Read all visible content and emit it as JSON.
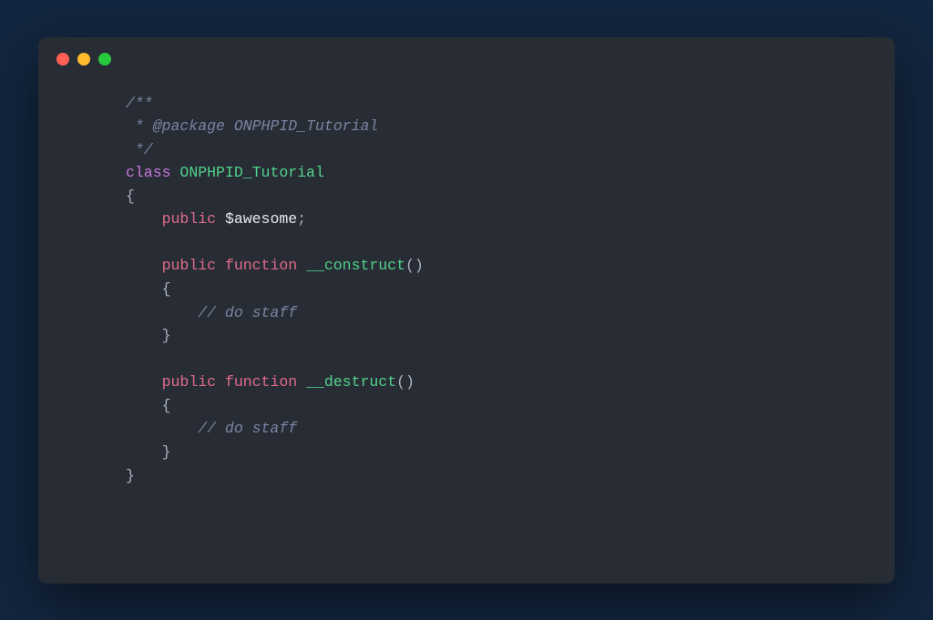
{
  "titlebar": {
    "dots": {
      "red": "#ff5f56",
      "yellow": "#ffbd2e",
      "green": "#27c93f"
    }
  },
  "code": {
    "c1": "/**",
    "c2": " * @package ONPHPID_Tutorial",
    "c3": " */",
    "kw_class": "class",
    "classname": "ONPHPID_Tutorial",
    "brace_open": "{",
    "kw_public1": "public",
    "var_awesome": "$awesome",
    "semi": ";",
    "kw_public2": "public",
    "kw_function1": "function",
    "func_construct": "__construct",
    "parens": "()",
    "brace_open2": "{",
    "comment_staff1": "// do staff",
    "brace_close2": "}",
    "kw_public3": "public",
    "kw_function2": "function",
    "func_destruct": "__destruct",
    "parens2": "()",
    "brace_open3": "{",
    "comment_staff2": "// do staff",
    "brace_close3": "}",
    "brace_close": "}"
  }
}
